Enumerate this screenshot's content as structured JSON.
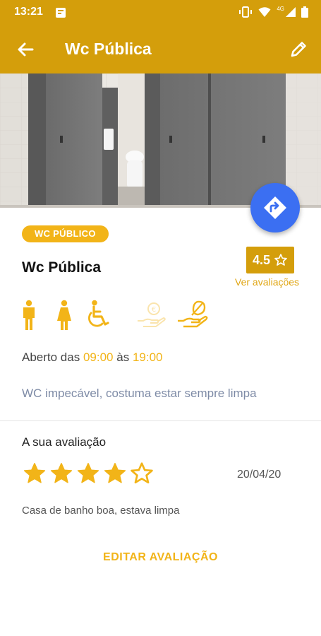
{
  "status_bar": {
    "time": "13:21",
    "network": "4G"
  },
  "app_bar": {
    "title": "Wc Pública",
    "background": "#d49e0b"
  },
  "place": {
    "type_badge": "WC PÚBLICO",
    "name": "Wc Pública",
    "rating": "4.5",
    "see_reviews": "Ver avaliações",
    "features": [
      "male-icon",
      "female-icon",
      "wheelchair-icon",
      "paid-icon",
      "hand-wash-icon"
    ],
    "hours_prefix": "Aberto das",
    "hours_open": "09:00",
    "hours_middle": "às",
    "hours_close": "19:00",
    "description": "WC impecável, costuma estar sempre limpa"
  },
  "my_review": {
    "heading": "A sua avaliação",
    "stars": 4,
    "max_stars": 5,
    "date": "20/04/20",
    "text": "Casa de banho boa, estava limpa",
    "edit_label": "EDITAR AVALIAÇÃO"
  },
  "colors": {
    "accent": "#f2b418",
    "primary": "#d49e0b",
    "fab": "#3b6ff2",
    "description": "#7e8ba6"
  }
}
